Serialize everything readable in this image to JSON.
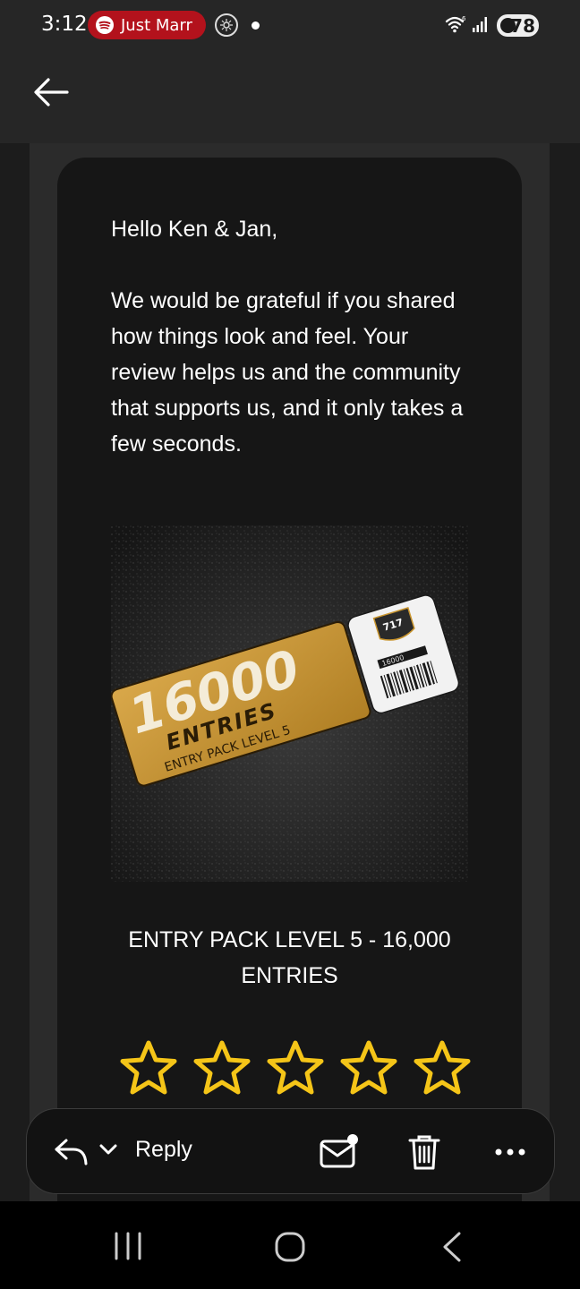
{
  "status_bar": {
    "time": "3:12",
    "media_label": "Just Marr",
    "battery_level": "78",
    "icons": [
      "spotify-icon",
      "app-icon",
      "wifi-6-icon",
      "signal-icon",
      "battery-icon"
    ]
  },
  "app_bar": {
    "back_icon": "arrow-left-icon"
  },
  "email": {
    "greeting": "Hello Ken & Jan,",
    "body": "We would be grateful if you shared how things look and feel. Your review helps us and the community that supports us, and it only takes a few seconds.",
    "product": {
      "image_text": {
        "count": "16000",
        "entries": "ENTRIES",
        "pack": "ENTRY PACK LEVEL 5",
        "badge_number": "717",
        "badge_count": "16000"
      },
      "title": "ENTRY PACK LEVEL 5 - 16,000 ENTRIES"
    },
    "rating": {
      "max_stars": 5,
      "selected": 0,
      "star_color": "#f5c518"
    }
  },
  "action_bar": {
    "reply_label": "Reply",
    "icons": [
      "reply-icon",
      "chevron-down-icon",
      "mark-unread-icon",
      "trash-icon",
      "more-icon"
    ]
  },
  "nav_bar": {
    "icons": [
      "recent-apps-icon",
      "home-icon",
      "back-icon"
    ]
  },
  "colors": {
    "status_bg": "#262626",
    "card_bg": "#161616",
    "spotify_pill": "#b3121c",
    "gold": "#c9952e"
  }
}
